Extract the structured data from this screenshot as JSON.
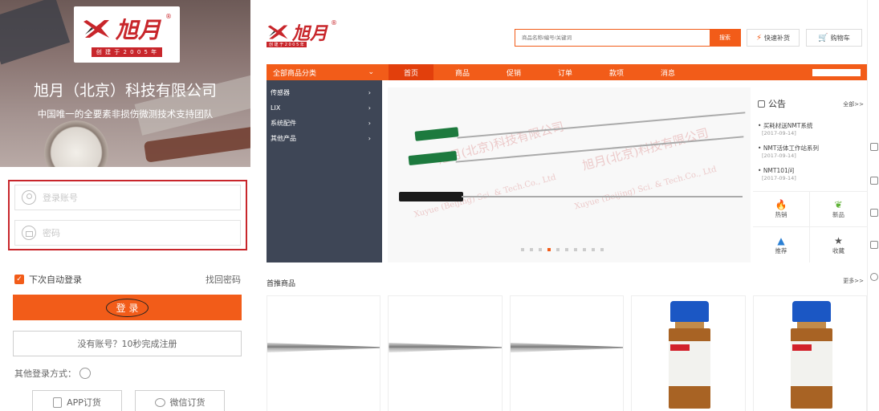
{
  "brand": {
    "logo_text": "旭月",
    "logo_reg": "®",
    "logo_tagline": "创 建 于 2 0 0 5 年",
    "brand_color": "#c8262b"
  },
  "login": {
    "company": "旭月（北京）科技有限公司",
    "slogan": "中国唯一的全要素非损伤微测技术支持团队",
    "username_placeholder": "登录账号",
    "password_placeholder": "密码",
    "remember_label": "下次自动登录",
    "forgot_label": "找回密码",
    "login_button": "登 录",
    "register_button": "没有账号？10秒完成注册",
    "other_login_label": "其他登录方式：",
    "app_order_button": "APP订货",
    "wechat_order_button": "微信订货",
    "accent_color": "#f25c19"
  },
  "store": {
    "search_placeholder": "商品名称/编号/关键词",
    "search_button": "搜索",
    "quick_button": "快速补货",
    "cart_button": "购物车",
    "nav": {
      "category_label": "全部商品分类",
      "items": [
        "首页",
        "商品",
        "促销",
        "订单",
        "款项",
        "消息"
      ]
    },
    "categories": [
      "传感器",
      "LIX",
      "系统配件",
      "其他产品"
    ],
    "banner": {
      "watermark_cn": "旭月(北京)科技有限公司",
      "watermark_en": "Xuyue (Beijing) Sci. & Tech.Co., Ltd",
      "active_dot": 3,
      "dot_count": 10
    },
    "notice": {
      "title": "公告",
      "all_label": "全部>>",
      "items": [
        {
          "title": "买耗材送NMT系统",
          "date": "[2017-09-14]"
        },
        {
          "title": "NMT活体工作站系列",
          "date": "[2017-09-14]"
        },
        {
          "title": "NMT101问",
          "date": "[2017-09-14]"
        }
      ],
      "quick_links": [
        {
          "label": "热销",
          "icon": "flame-icon"
        },
        {
          "label": "新品",
          "icon": "leaf-icon"
        },
        {
          "label": "推荐",
          "icon": "mountain-icon"
        },
        {
          "label": "收藏",
          "icon": "star-icon"
        }
      ]
    },
    "recommended_title": "首推商品",
    "more_label": "更多>>",
    "products": [
      {
        "type": "needle"
      },
      {
        "type": "needle"
      },
      {
        "type": "needle"
      },
      {
        "type": "vial"
      },
      {
        "type": "vial"
      }
    ]
  }
}
